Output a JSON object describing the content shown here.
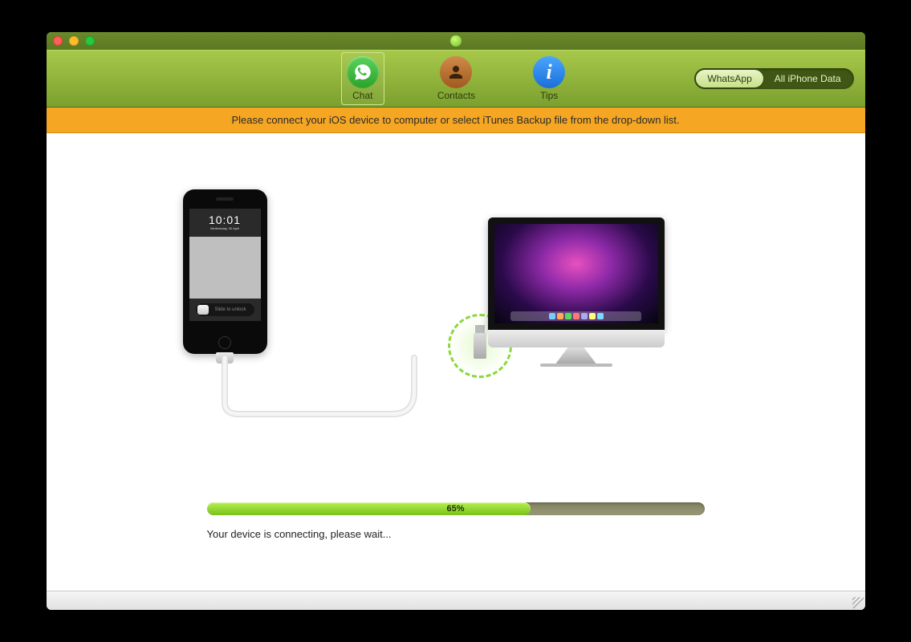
{
  "tabs": {
    "chat": "Chat",
    "contacts": "Contacts",
    "tips": "Tips"
  },
  "modes": {
    "whatsapp": "WhatsApp",
    "all_iphone": "All iPhone Data"
  },
  "instruction": "Please connect your iOS device to computer or select iTunes Backup file from the drop-down list.",
  "phone": {
    "time": "10:01",
    "date": "Wednesday, 30 April",
    "slide_label": "Slide to unlock"
  },
  "progress": {
    "percent": 65,
    "label": "65%"
  },
  "status": "Your device is connecting, please wait...",
  "imac": {
    "logo": ""
  }
}
